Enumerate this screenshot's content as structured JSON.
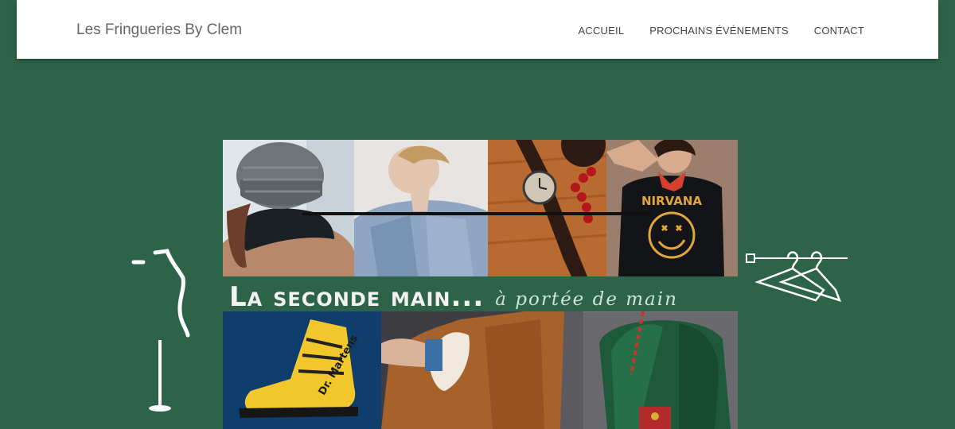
{
  "nav": {
    "brand": "Les Fringueries By Clem",
    "links": [
      {
        "label": "ACCUEIL"
      },
      {
        "label": "PROCHAINS ÉVÉNEMENTS"
      },
      {
        "label": "CONTACT"
      }
    ]
  },
  "hero": {
    "headline_main": "La seconde main...",
    "headline_sub": "à portée de main",
    "nirvana_text": "NIRVANA",
    "boot_brand": "Dr. Martens"
  },
  "colors": {
    "background": "#2d6349",
    "navbar": "#ffffff",
    "nav_text": "#444444"
  },
  "icons": [
    "mannequin-icon",
    "hangers-icon"
  ]
}
